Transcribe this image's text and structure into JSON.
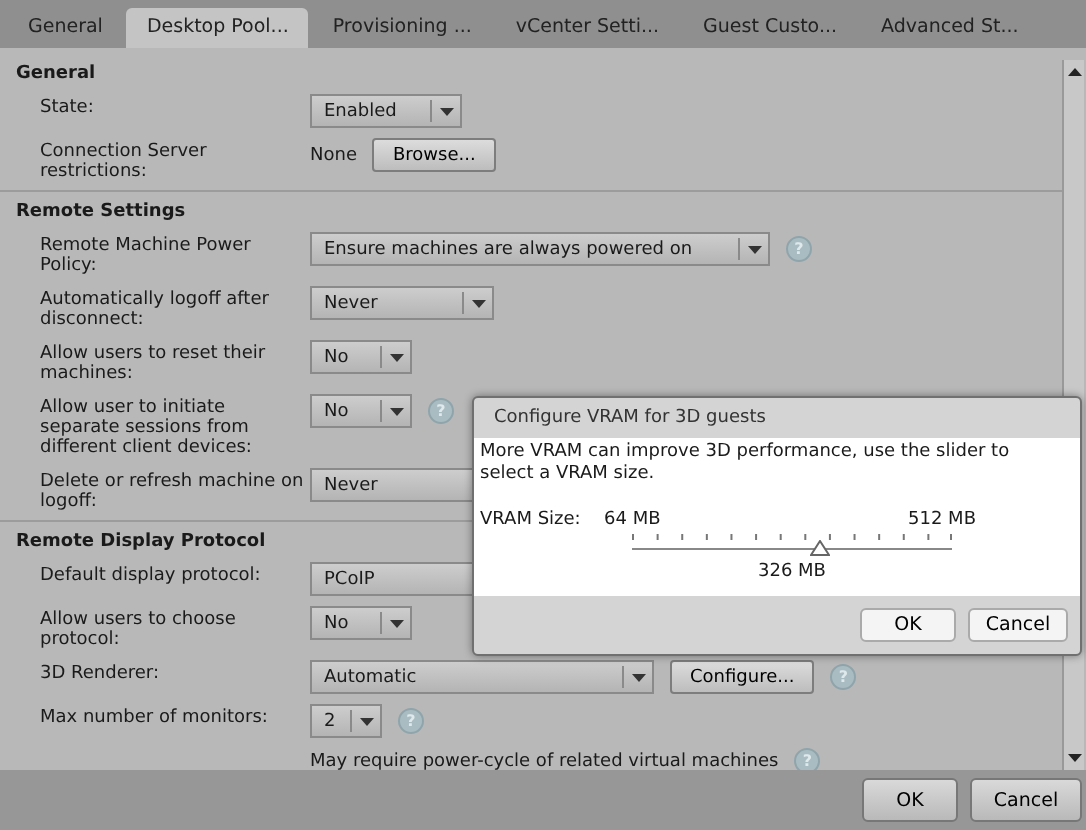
{
  "tabs": [
    {
      "label": "General",
      "selected": false
    },
    {
      "label": "Desktop Pool...",
      "selected": true
    },
    {
      "label": "Provisioning ...",
      "selected": false
    },
    {
      "label": "vCenter Setti...",
      "selected": false
    },
    {
      "label": "Guest Custo...",
      "selected": false
    },
    {
      "label": "Advanced St...",
      "selected": false
    }
  ],
  "sections": [
    {
      "title": "General",
      "rows": [
        {
          "label": "State:",
          "controls": [
            {
              "kind": "select",
              "value": "Enabled"
            }
          ]
        },
        {
          "label": "Connection Server restrictions:",
          "controls": [
            {
              "kind": "text",
              "text": "None"
            },
            {
              "kind": "button",
              "text": "Browse..."
            }
          ]
        }
      ]
    },
    {
      "title": "Remote Settings",
      "rows": [
        {
          "label": "Remote Machine Power Policy:",
          "controls": [
            {
              "kind": "select",
              "value": "Ensure machines are always powered on"
            },
            {
              "kind": "help",
              "text": "?"
            }
          ]
        },
        {
          "label": "Automatically logoff after disconnect:",
          "controls": [
            {
              "kind": "select",
              "value": "Never"
            }
          ]
        },
        {
          "label": "Allow users to reset their machines:",
          "controls": [
            {
              "kind": "select",
              "value": "No"
            }
          ]
        },
        {
          "label": "Allow user to initiate separate sessions from different client devices:",
          "controls": [
            {
              "kind": "select",
              "value": "No"
            },
            {
              "kind": "help",
              "text": "?"
            }
          ]
        },
        {
          "label": "Delete or refresh machine on logoff:",
          "controls": [
            {
              "kind": "select",
              "value": "Never"
            }
          ]
        }
      ]
    },
    {
      "title": "Remote Display Protocol",
      "rows": [
        {
          "label": "Default display protocol:",
          "controls": [
            {
              "kind": "select",
              "value": "PCoIP"
            }
          ]
        },
        {
          "label": "Allow users to choose protocol:",
          "controls": [
            {
              "kind": "select",
              "value": "No"
            }
          ]
        },
        {
          "label": "3D Renderer:",
          "controls": [
            {
              "kind": "select",
              "value": "Automatic"
            },
            {
              "kind": "button",
              "text": "Configure..."
            },
            {
              "kind": "help",
              "text": "?"
            }
          ]
        },
        {
          "label": "Max number of monitors:",
          "controls": [
            {
              "kind": "select",
              "value": "2"
            },
            {
              "kind": "help",
              "text": "?"
            }
          ]
        },
        {
          "label": "",
          "controls": [
            {
              "kind": "text",
              "text": "May require power-cycle of related virtual machines"
            },
            {
              "kind": "help",
              "text": "?"
            }
          ]
        }
      ]
    }
  ],
  "buttons": [
    "OK",
    "Cancel"
  ],
  "dialog": {
    "title": "Configure VRAM for 3D guests",
    "message": "More VRAM can improve 3D performance, use the slider to select a VRAM size.",
    "slider_label": "VRAM Size:",
    "min_label": "64 MB",
    "max_label": "512 MB",
    "level": 0.585,
    "reading": "326 MB",
    "buttons": [
      "OK",
      "Cancel"
    ]
  }
}
